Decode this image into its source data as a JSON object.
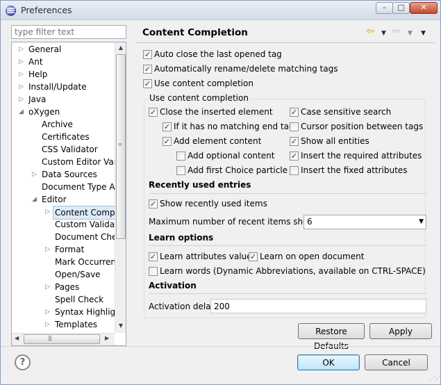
{
  "window": {
    "title": "Preferences",
    "controls": {
      "minimize": "–",
      "maximize": "□",
      "close": "✕"
    }
  },
  "filter": {
    "placeholder": "type filter text"
  },
  "tree": {
    "items": [
      {
        "label": "General",
        "expandable": true,
        "expanded": false
      },
      {
        "label": "Ant",
        "expandable": true,
        "expanded": false
      },
      {
        "label": "Help",
        "expandable": true,
        "expanded": false
      },
      {
        "label": "Install/Update",
        "expandable": true,
        "expanded": false
      },
      {
        "label": "Java",
        "expandable": true,
        "expanded": false
      },
      {
        "label": "oXygen",
        "expandable": true,
        "expanded": true
      },
      {
        "label": "Archive",
        "expandable": false
      },
      {
        "label": "Certificates",
        "expandable": false
      },
      {
        "label": "CSS Validator",
        "expandable": false
      },
      {
        "label": "Custom Editor Varia",
        "expandable": false
      },
      {
        "label": "Data Sources",
        "expandable": true,
        "expanded": false
      },
      {
        "label": "Document Type Ass",
        "expandable": false
      },
      {
        "label": "Editor",
        "expandable": true,
        "expanded": true
      },
      {
        "label": "Content Comple",
        "expandable": true,
        "expanded": false,
        "selected": true
      },
      {
        "label": "Custom Validatio",
        "expandable": false
      },
      {
        "label": "Document Chec",
        "expandable": false
      },
      {
        "label": "Format",
        "expandable": true,
        "expanded": false
      },
      {
        "label": "Mark Occurrence",
        "expandable": false
      },
      {
        "label": "Open/Save",
        "expandable": false
      },
      {
        "label": "Pages",
        "expandable": true,
        "expanded": false
      },
      {
        "label": "Spell Check",
        "expandable": false
      },
      {
        "label": "Syntax Highlight",
        "expandable": true,
        "expanded": false
      },
      {
        "label": "Templates",
        "expandable": true,
        "expanded": false
      }
    ]
  },
  "panel": {
    "title": "Content Completion",
    "top_options": {
      "auto_close": {
        "label": "Auto close the last opened tag",
        "checked": true
      },
      "auto_rename": {
        "label": "Automatically rename/delete matching tags",
        "checked": true
      },
      "use_cc": {
        "label": "Use content completion",
        "checked": true
      }
    },
    "group_label": "Use content completion",
    "group": {
      "close_inserted": {
        "label": "Close the inserted element",
        "checked": true
      },
      "no_matching_end": {
        "label": "If it has no matching end tag",
        "checked": true
      },
      "add_element_content": {
        "label": "Add element content",
        "checked": true
      },
      "add_optional": {
        "label": "Add optional content",
        "checked": false
      },
      "add_first_choice": {
        "label": "Add first Choice particle",
        "checked": false
      },
      "case_sensitive": {
        "label": "Case sensitive search",
        "checked": true
      },
      "cursor_between": {
        "label": "Cursor position between tags",
        "checked": false
      },
      "show_all": {
        "label": "Show all entities",
        "checked": true
      },
      "insert_required": {
        "label": "Insert the required attributes",
        "checked": true
      },
      "insert_fixed": {
        "label": "Insert the fixed attributes",
        "checked": false
      }
    },
    "recent": {
      "heading": "Recently used entries",
      "show_recent": {
        "label": "Show recently used items",
        "checked": true
      },
      "max_label": "Maximum number of recent items shown",
      "max_value": "6"
    },
    "learn": {
      "heading": "Learn options",
      "learn_attr": {
        "label": "Learn attributes values",
        "checked": true
      },
      "learn_open": {
        "label": "Learn on open document",
        "checked": true
      },
      "learn_words": {
        "label": "Learn words (Dynamic Abbreviations, available on CTRL-SPACE)",
        "checked": false
      }
    },
    "activation": {
      "heading": "Activation",
      "delay_label": "Activation delay",
      "delay_value": "200"
    },
    "buttons": {
      "restore": "Restore Defaults",
      "apply": "Apply"
    }
  },
  "footer": {
    "help": "?",
    "ok": "OK",
    "cancel": "Cancel"
  }
}
